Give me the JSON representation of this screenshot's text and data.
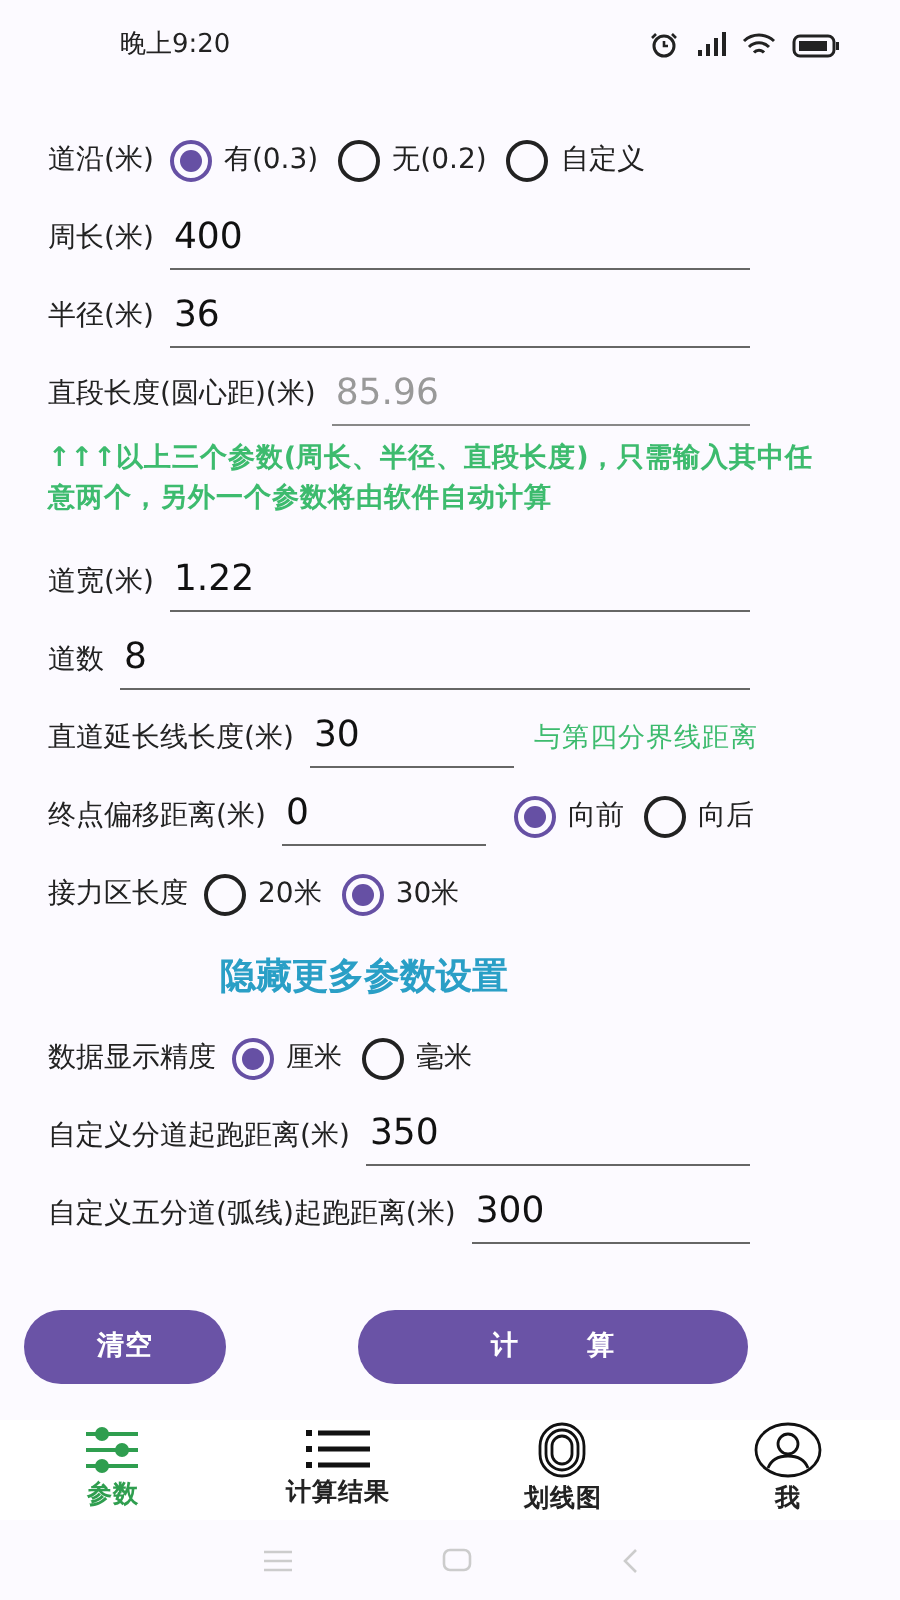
{
  "status_bar": {
    "time": "晚上9:20"
  },
  "form": [
    {
      "kind": "radio",
      "label": "道沿(米)",
      "options": [
        {
          "label": "有(0.3)",
          "selected": true
        },
        {
          "label": "无(0.2)",
          "selected": false
        },
        {
          "label": "自定义",
          "selected": false
        }
      ]
    },
    {
      "kind": "input",
      "label": "周长(米)",
      "value": "400",
      "disabled": false
    },
    {
      "kind": "input",
      "label": "半径(米)",
      "value": "36",
      "disabled": false
    },
    {
      "kind": "input",
      "label": "直段长度(圆心距)(米)",
      "value": "85.96",
      "disabled": true
    },
    {
      "kind": "note",
      "text": "↑↑↑以上三个参数(周长、半径、直段长度)，只需输入其中任意两个，另外一个参数将由软件自动计算"
    },
    {
      "kind": "input",
      "label": "道宽(米)",
      "value": "1.22",
      "disabled": false
    },
    {
      "kind": "input",
      "label": "道数",
      "value": "8",
      "disabled": false
    },
    {
      "kind": "input_hint",
      "label": "直道延长线长度(米)",
      "value": "30",
      "hint": "与第四分界线距离"
    },
    {
      "kind": "input_radio",
      "label": "终点偏移距离(米)",
      "value": "0",
      "options": [
        {
          "label": "向前",
          "selected": true
        },
        {
          "label": "向后",
          "selected": false
        }
      ]
    },
    {
      "kind": "radio",
      "label": "接力区长度",
      "options": [
        {
          "label": "20米",
          "selected": false
        },
        {
          "label": "30米",
          "selected": true
        }
      ]
    },
    {
      "kind": "link",
      "text": "隐藏更多参数设置"
    },
    {
      "kind": "radio",
      "label": "数据显示精度",
      "options": [
        {
          "label": "厘米",
          "selected": true
        },
        {
          "label": "毫米",
          "selected": false
        }
      ]
    },
    {
      "kind": "input",
      "label": "自定义分道起跑距离(米)",
      "value": "350",
      "disabled": false
    },
    {
      "kind": "input",
      "label": "自定义五分道(弧线)起跑距离(米)",
      "value": "300",
      "disabled": false
    }
  ],
  "buttons": [
    {
      "kind": "small",
      "label": "清空"
    },
    {
      "kind": "wide",
      "label": "计 算"
    }
  ],
  "tabs": [
    {
      "label": "参数",
      "selected": true
    },
    {
      "label": "计算结果",
      "selected": false
    },
    {
      "label": "划线图",
      "selected": false
    },
    {
      "label": "我",
      "selected": false
    }
  ]
}
